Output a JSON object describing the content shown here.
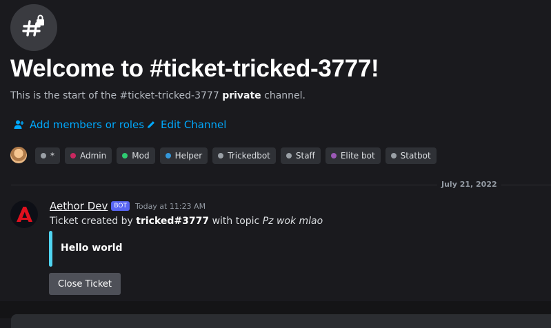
{
  "welcome": {
    "title": "Welcome to #ticket-tricked-3777!",
    "subtitle_prefix": "This is the start of the #ticket-tricked-3777 ",
    "subtitle_bold": "private",
    "subtitle_suffix": " channel."
  },
  "actions": {
    "add_members": "Add members or roles",
    "edit_channel": "Edit Channel"
  },
  "roles": [
    {
      "label": "*",
      "color": "#9aa0a6"
    },
    {
      "label": "Admin",
      "color": "#c9275f"
    },
    {
      "label": "Mod",
      "color": "#2ecc71"
    },
    {
      "label": "Helper",
      "color": "#3498db"
    },
    {
      "label": "Trickedbot",
      "color": "#9aa0a6"
    },
    {
      "label": "Staff",
      "color": "#9aa0a6"
    },
    {
      "label": "Elite bot",
      "color": "#9b59b6"
    },
    {
      "label": "Statbot",
      "color": "#9aa0a6"
    }
  ],
  "divider": {
    "date": "July 21, 2022"
  },
  "message": {
    "author": "Aethor Dev",
    "bot_tag": "BOT",
    "timestamp": "Today at 11:23 AM",
    "text_prefix": "Ticket created by ",
    "text_user": "tricked#3777",
    "text_middle": " with topic ",
    "text_topic": "Pz wok mlao",
    "embed_text": "Hello world",
    "button_label": "Close Ticket"
  },
  "colors": {
    "background": "#1a1a1e",
    "link": "#00a8fc",
    "bot_tag": "#5865f2",
    "embed_bar": "#4fd4f0",
    "button": "#4e5058",
    "avatar_logo": "#e0101e"
  },
  "icons": {
    "channel": "hashtag-lock-icon",
    "add_members": "add-member-icon",
    "edit": "pencil-icon",
    "bot_avatar": "letter-a-logo-icon"
  }
}
